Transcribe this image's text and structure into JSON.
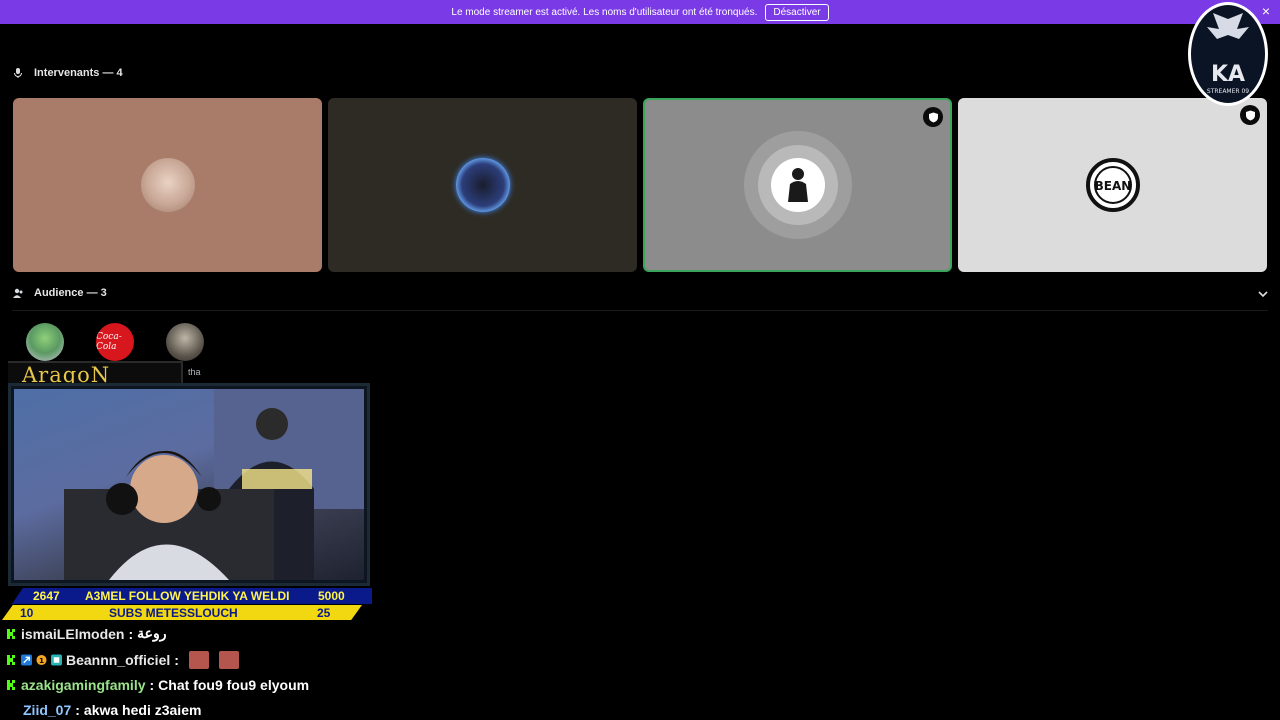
{
  "banner": {
    "message": "Le mode streamer est activé. Les noms d'utilisateur ont été tronqués.",
    "button_label": "Désactiver",
    "close_glyph": "×",
    "bg_color": "#7a3be6"
  },
  "speakers": {
    "heading": "Intervenants — 4",
    "icon": "microphone-icon",
    "tiles": [
      {
        "bg": "#a87c68",
        "avatar": "face-avatar",
        "speaking": false,
        "shield": false
      },
      {
        "bg": "#2e2b24",
        "avatar": "city-night-avatar",
        "speaking": false,
        "shield": false
      },
      {
        "bg": "#8c8c8c",
        "avatar": "person-avatar",
        "speaking": true,
        "shield": true
      },
      {
        "bg": "#dcdcdc",
        "avatar": "bean-logo-avatar",
        "speaking": false,
        "shield": true
      }
    ]
  },
  "audience": {
    "heading": "Audience — 3",
    "icon": "people-icon",
    "members": [
      {
        "avatar": "character-avatar"
      },
      {
        "avatar": "coca-cola-avatar",
        "logo_text": "Coca-Cola"
      },
      {
        "avatar": "person-dark-avatar",
        "name_partial": "tha"
      }
    ]
  },
  "overlay": {
    "streamer_name": "AragoN",
    "ticker_top": {
      "left": "2647",
      "center": "A3MEL FOLLOW YEHDIK YA WELDI",
      "right": "5000"
    },
    "ticker_bottom": {
      "left": "10",
      "center": "SUBS METESSLOUCH",
      "right": "25"
    }
  },
  "chat": [
    {
      "user": "ismaiLElmoden",
      "message": "روعة",
      "user_color": "#e8e8e8",
      "badges": [
        "kick-icon"
      ]
    },
    {
      "user": "Beannn_officiel",
      "message": "",
      "user_color": "#e8e8e8",
      "badges": [
        "kick-icon",
        "prime-icon",
        "gift-icon",
        "sub-icon"
      ],
      "emotes": [
        "emote",
        "emote"
      ]
    },
    {
      "user": "azakigamingfamily",
      "message": "Chat fou9 fou9 elyoum",
      "user_color": "#9be38b",
      "badges": [
        "kick-icon"
      ]
    },
    {
      "user": "Ziid_07",
      "message": "akwa hedi z3aiem",
      "user_color": "#8fc6ff",
      "badges": []
    }
  ],
  "brand_logo": {
    "text": "KA",
    "sub_text": "STREAMER 09"
  }
}
